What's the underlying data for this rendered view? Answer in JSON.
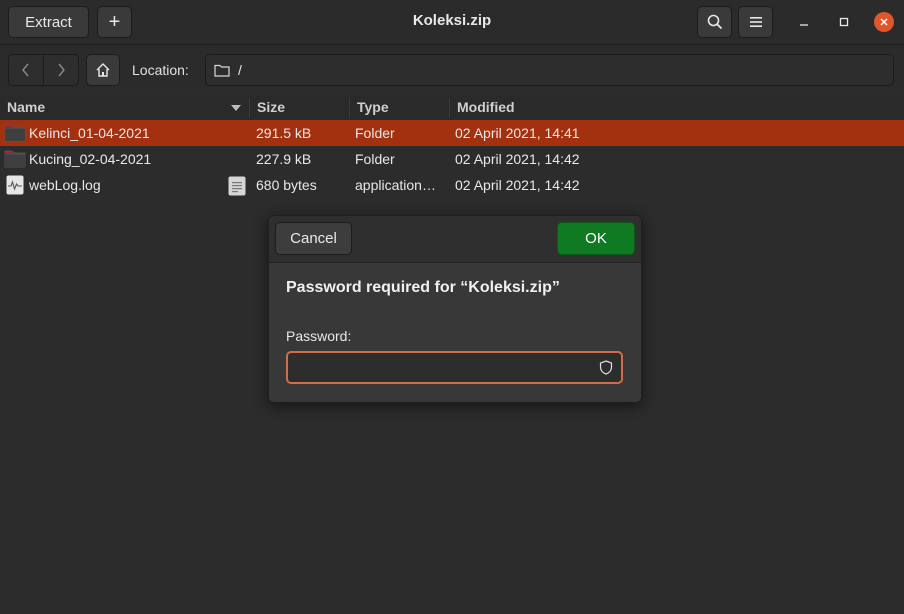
{
  "window": {
    "title": "Koleksi.zip"
  },
  "toolbar": {
    "extract_label": "Extract",
    "add_label": "+"
  },
  "location": {
    "label": "Location:",
    "path": "/"
  },
  "columns": {
    "name": "Name",
    "size": "Size",
    "type": "Type",
    "modified": "Modified"
  },
  "files": [
    {
      "name": "Kelinci_01-04-2021",
      "size": "291.5 kB",
      "type": "Folder",
      "modified": "02 April 2021, 14:41",
      "icon": "folder-icon",
      "selected": true
    },
    {
      "name": "Kucing_02-04-2021",
      "size": "227.9 kB",
      "type": "Folder",
      "modified": "02 April 2021, 14:42",
      "icon": "folder-icon",
      "selected": false
    },
    {
      "name": "webLog.log",
      "size": "680 bytes",
      "type": "application…",
      "modified": "02 April 2021, 14:42",
      "icon": "log-file-icon",
      "selected": false
    }
  ],
  "dialog": {
    "cancel_label": "Cancel",
    "ok_label": "OK",
    "heading": "Password required for “Koleksi.zip”",
    "password_label": "Password:",
    "password_value": ""
  },
  "colors": {
    "accent": "#a3300f",
    "ok": "#107a23",
    "close": "#e0552b",
    "focus": "#d16d48"
  }
}
